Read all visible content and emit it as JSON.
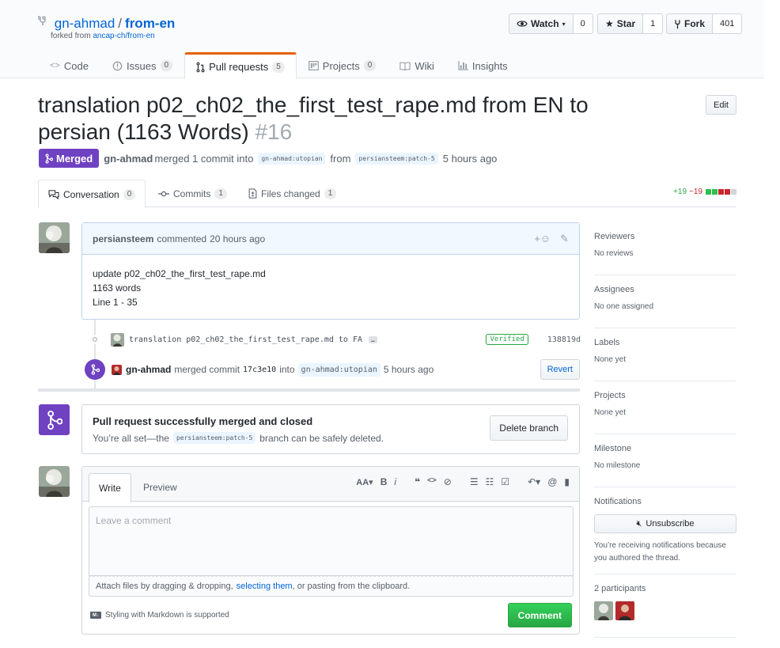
{
  "repo": {
    "owner": "gn-ahmad",
    "separator": "/",
    "name": "from-en",
    "forked_prefix": "forked from",
    "forked_source": "ancap-ch/from-en"
  },
  "social": {
    "watch_label": "Watch",
    "watch_count": "0",
    "star_label": "Star",
    "star_count": "1",
    "fork_label": "Fork",
    "fork_count": "401"
  },
  "nav": [
    {
      "label": "Code",
      "count": "",
      "icon": "code-icon"
    },
    {
      "label": "Issues",
      "count": "0",
      "icon": "issue-icon"
    },
    {
      "label": "Pull requests",
      "count": "5",
      "icon": "pull-request-icon"
    },
    {
      "label": "Projects",
      "count": "0",
      "icon": "project-icon"
    },
    {
      "label": "Wiki",
      "count": "",
      "icon": "book-icon"
    },
    {
      "label": "Insights",
      "count": "",
      "icon": "graph-icon"
    }
  ],
  "pr": {
    "title": "translation p02_ch02_the_first_test_rape.md from EN to persian (1163 Words)",
    "number": "#16",
    "edit_label": "Edit",
    "state": "Merged",
    "author": "gn-ahmad",
    "action": "merged 1 commit into",
    "base": "gn-ahmad:utopian",
    "from_word": "from",
    "head": "persiansteem:patch-5",
    "time": "5 hours ago"
  },
  "tabs": [
    {
      "label": "Conversation",
      "count": "0",
      "icon": "comment-discussion-icon"
    },
    {
      "label": "Commits",
      "count": "1",
      "icon": "commit-icon"
    },
    {
      "label": "Files changed",
      "count": "1",
      "icon": "file-diff-icon"
    }
  ],
  "diffstat": {
    "additions": "+19",
    "deletions": "−19"
  },
  "comment": {
    "author": "persiansteem",
    "verb": "commented",
    "time": "20 hours ago",
    "lines": [
      "update p02_ch02_the_first_test_rape.md",
      "1163 words",
      "Line 1 - 35"
    ]
  },
  "commit": {
    "message": "translation p02_ch02_the_first_test_rape.md to FA",
    "ellipsis": "…",
    "verified": "Verified",
    "sha": "138819d"
  },
  "merge_event": {
    "actor": "gn-ahmad",
    "text": "merged commit",
    "sha": "17c3e10",
    "into": "into",
    "ref": "gn-ahmad:utopian",
    "time": "5 hours ago",
    "revert_label": "Revert"
  },
  "merged_box": {
    "title": "Pull request successfully merged and closed",
    "prefix": "You’re all set—the",
    "branch": "persiansteem:patch-5",
    "suffix": "branch can be safely deleted.",
    "delete_label": "Delete branch"
  },
  "composer": {
    "write_tab": "Write",
    "preview_tab": "Preview",
    "placeholder": "Leave a comment",
    "attach_prefix": "Attach files by dragging & dropping,",
    "attach_link": "selecting them",
    "attach_suffix": ", or pasting from the clipboard.",
    "markdown_note": "Styling with Markdown is supported",
    "submit_label": "Comment"
  },
  "sidebar": {
    "reviewers": {
      "heading": "Reviewers",
      "value": "No reviews"
    },
    "assignees": {
      "heading": "Assignees",
      "value": "No one assigned"
    },
    "labels": {
      "heading": "Labels",
      "value": "None yet"
    },
    "projects": {
      "heading": "Projects",
      "value": "None yet"
    },
    "milestone": {
      "heading": "Milestone",
      "value": "No milestone"
    },
    "notifications": {
      "heading": "Notifications",
      "button": "Unsubscribe",
      "reason": "You’re receiving notifications because you authored the thread."
    },
    "participants": {
      "heading": "2 participants"
    }
  },
  "colors": {
    "merged": "#6f42c1",
    "link": "#0366d6",
    "accent_tab": "#e36209",
    "green": "#28a745",
    "red": "#cb2431"
  }
}
